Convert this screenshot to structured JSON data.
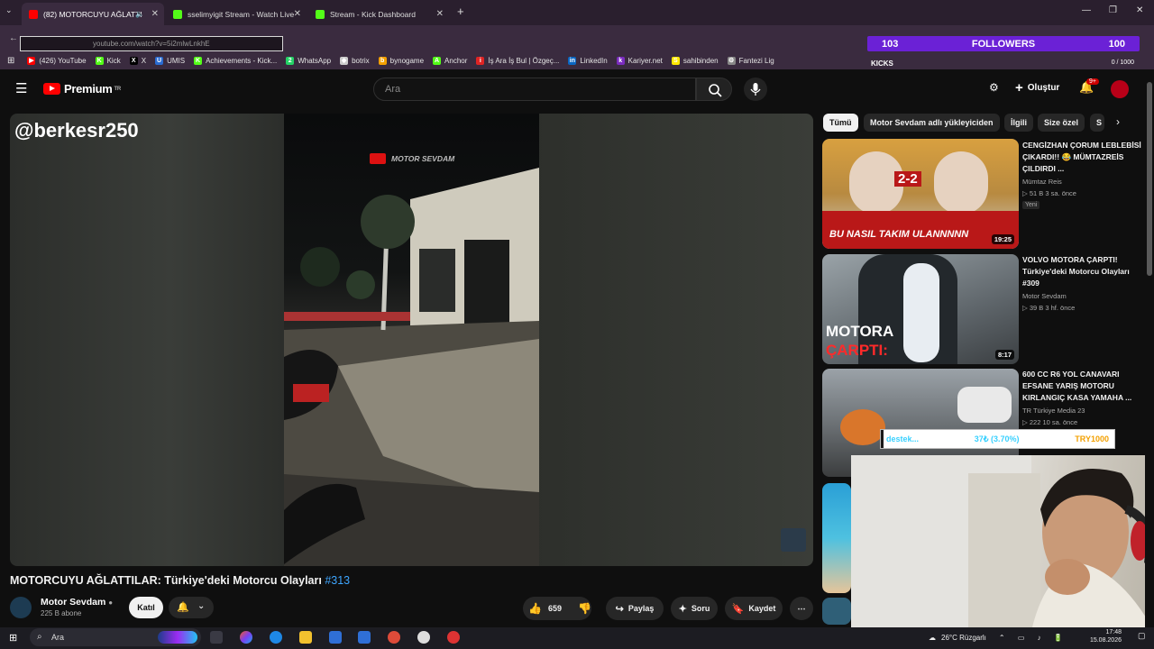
{
  "browser": {
    "tabs": [
      {
        "label": "(82) MOTORCUYU AĞLATTI",
        "active": true,
        "color": "#ff0000"
      },
      {
        "label": "sselimyigit Stream - Watch Live",
        "active": false,
        "color": "#53fc18"
      },
      {
        "label": "Stream - Kick Dashboard",
        "active": false,
        "color": "#53fc18"
      }
    ],
    "new_tab": "+",
    "url": "youtube.com/watch?v=5i2mlwLnkhE",
    "bookmarks": [
      {
        "label": "(426) YouTube",
        "icon": "youtube-icon",
        "color": "#ff0000",
        "glyph": "▶"
      },
      {
        "label": "Kick",
        "icon": "kick-icon",
        "color": "#53fc18",
        "glyph": "K"
      },
      {
        "label": "X",
        "icon": "x-icon",
        "color": "#000000",
        "glyph": "X"
      },
      {
        "label": "UMIS",
        "icon": "umis-icon",
        "color": "#2a6bd1",
        "glyph": "U"
      },
      {
        "label": "Achievements - Kick...",
        "icon": "kick-icon",
        "color": "#53fc18",
        "glyph": "K"
      },
      {
        "label": "WhatsApp",
        "icon": "whatsapp-icon",
        "color": "#25d366",
        "glyph": "2"
      },
      {
        "label": "botrix",
        "icon": "botrix-icon",
        "color": "#cccccc",
        "glyph": "◆"
      },
      {
        "label": "bynogame",
        "icon": "bynogame-icon",
        "color": "#f3a000",
        "glyph": "b"
      },
      {
        "label": "Anchor",
        "icon": "anchor-icon",
        "color": "#53fc18",
        "glyph": "A"
      },
      {
        "label": "İş Ara İş Bul | Özgeç...",
        "icon": "kariyer-icon",
        "color": "#e02424",
        "glyph": "i"
      },
      {
        "label": "LinkedIn",
        "icon": "linkedin-icon",
        "color": "#0a66c2",
        "glyph": "in"
      },
      {
        "label": "Kariyer.net",
        "icon": "kariyer-net-icon",
        "color": "#7b2cbf",
        "glyph": "k"
      },
      {
        "label": "sahibinden",
        "icon": "sahibinden-icon",
        "color": "#ffe800",
        "glyph": "S"
      },
      {
        "label": "Fantezi Lig",
        "icon": "fantezi-icon",
        "color": "#888888",
        "glyph": "⚙"
      }
    ]
  },
  "overlay": {
    "followers_current": "103",
    "followers_label": "FOLLOWERS",
    "followers_goal": "100",
    "kicks_label": "KICKS",
    "kicks_count": "0 / 1000",
    "donation_label": "destek...",
    "donation_percent_text": "37₺ (3.70%)",
    "donation_goal": "TRY1000",
    "donation_fraction": 0.037
  },
  "youtube": {
    "logo_text": "Premium",
    "logo_region": "TR",
    "search_placeholder": "Ara",
    "create_label": "Oluştur",
    "notif_count": "9+",
    "chips": [
      "Tümü",
      "Motor Sevdam adlı yükleyiciden",
      "İlgili",
      "Size özel",
      "S"
    ],
    "video": {
      "handle_overlay": "@berkesr250",
      "watermark": "MOTOR SEVDAM",
      "title": "MOTORCUYU AĞLATTILAR: Türkiye'deki Motorcu Olayları",
      "hashtag": "#313",
      "channel": "Motor Sevdam",
      "subscribers": "225 B abone",
      "join_label": "Katıl",
      "likes": "659",
      "share_label": "Paylaş",
      "ask_label": "Soru",
      "save_label": "Kaydet"
    },
    "recommendations": [
      {
        "title": "CENGİZHAN ÇORUM LEBLEBİSİ ÇIKARDI!! 😂 MÜMTAZREİS ÇILDIRDI ...",
        "channel": "Mümtaz Reis",
        "meta": "▷ 51 B  3 sa. önce",
        "duration": "19:25",
        "badge": "Yeni",
        "thumb_text": "BU NASIL TAKIM ULANNNNN",
        "thumb_score": "2-2"
      },
      {
        "title": "VOLVO MOTORA ÇARPTI! Türkiye'deki Motorcu Olayları #309",
        "channel": "Motor Sevdam",
        "meta": "▷ 39 B  3 hf. önce",
        "duration": "8:17",
        "badge": "",
        "thumb_text": "MOTORA",
        "thumb_text2": "ÇARPTI:"
      },
      {
        "title": "600 CC R6 YOL CANAVARI EFSANE YARIŞ MOTORU KIRLANGIÇ KASA YAMAHA ...",
        "channel": "TR Türkiye Media 23",
        "meta": "▷ 222  10 sa. önce",
        "duration": "",
        "badge": ""
      }
    ]
  },
  "taskbar": {
    "search_label": "Ara",
    "weather": "26°C Rüzgarlı",
    "time": "17:48",
    "date": "15.08.2026"
  }
}
